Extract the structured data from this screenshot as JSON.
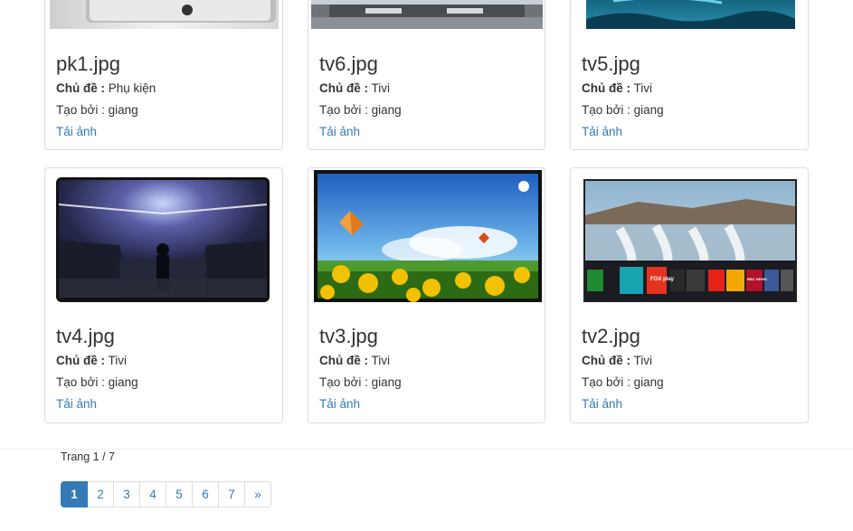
{
  "labels": {
    "topic": "Chủ đề :",
    "created_by": "Tạo bởi :",
    "download": "Tải ảnh"
  },
  "cards": [
    {
      "filename": "pk1.jpg",
      "topic": "Phụ kiện",
      "creator": "giang"
    },
    {
      "filename": "tv6.jpg",
      "topic": "Tivi",
      "creator": "giang"
    },
    {
      "filename": "tv5.jpg",
      "topic": "Tivi",
      "creator": "giang"
    },
    {
      "filename": "tv4.jpg",
      "topic": "Tivi",
      "creator": "giang"
    },
    {
      "filename": "tv3.jpg",
      "topic": "Tivi",
      "creator": "giang"
    },
    {
      "filename": "tv2.jpg",
      "topic": "Tivi",
      "creator": "giang"
    }
  ],
  "tv2_apps": {
    "fox": "FOX play",
    "bbc": "BBC NEWS"
  },
  "pager": {
    "text": "Trang 1 / 7",
    "pages": [
      "1",
      "2",
      "3",
      "4",
      "5",
      "6",
      "7"
    ],
    "next": "»",
    "current": "1"
  },
  "colors": {
    "link": "#337ab7",
    "border": "#dddddd",
    "active_page_bg": "#337ab7"
  }
}
